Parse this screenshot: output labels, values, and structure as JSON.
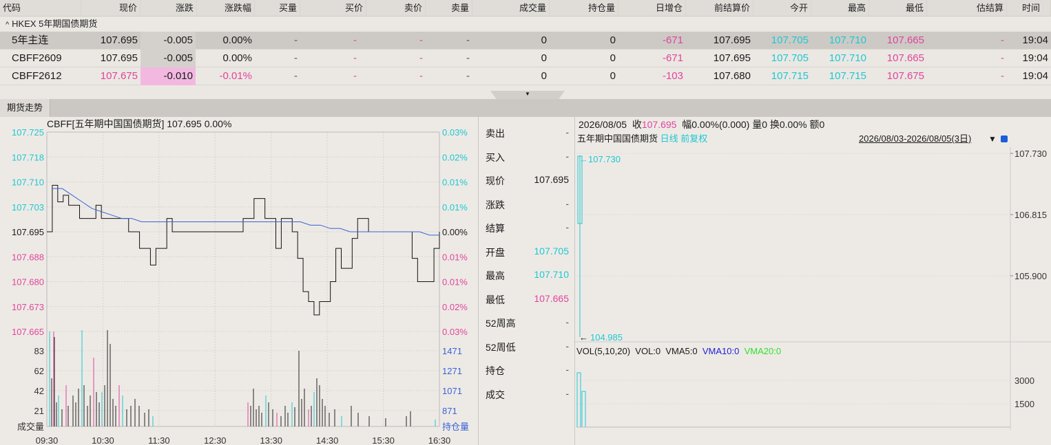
{
  "quote_table": {
    "headers": [
      "代码",
      "现价",
      "涨跌",
      "涨跌幅",
      "买量",
      "买价",
      "卖价",
      "卖量",
      "成交量",
      "持仓量",
      "日增仓",
      "前结算价",
      "今开",
      "最高",
      "最低",
      "估结算",
      "时间"
    ],
    "group_label": "HKEX 5年期国债期货",
    "rows": [
      {
        "code": "5年主连",
        "price": "107.695",
        "change": "-0.005",
        "pct": "0.00%",
        "bid_vol": "-",
        "bid": "-",
        "ask": "-",
        "ask_vol": "-",
        "volume": "0",
        "oi": "0",
        "oi_chg": "-671",
        "prev_settle": "107.695",
        "open": "107.705",
        "high": "107.710",
        "low": "107.665",
        "est_settle": "-",
        "time": "19:04"
      },
      {
        "code": "CBFF2609",
        "price": "107.695",
        "change": "-0.005",
        "pct": "0.00%",
        "bid_vol": "-",
        "bid": "-",
        "ask": "-",
        "ask_vol": "-",
        "volume": "0",
        "oi": "0",
        "oi_chg": "-671",
        "prev_settle": "107.695",
        "open": "107.705",
        "high": "107.710",
        "low": "107.665",
        "est_settle": "-",
        "time": "19:04"
      },
      {
        "code": "CBFF2612",
        "price": "107.675",
        "change": "-0.010",
        "pct": "-0.01%",
        "bid_vol": "-",
        "bid": "-",
        "ask": "-",
        "ask_vol": "-",
        "volume": "0",
        "oi": "0",
        "oi_chg": "-103",
        "prev_settle": "107.680",
        "open": "107.715",
        "high": "107.715",
        "low": "107.675",
        "est_settle": "-",
        "time": "19:04"
      }
    ]
  },
  "tab_label": "期货走势",
  "intraday": {
    "title": "CBFF[五年期中国国债期货]  107.695   0.00%",
    "price_ticks": [
      "107.725",
      "107.718",
      "107.710",
      "107.703",
      "107.695",
      "107.688",
      "107.680",
      "107.673",
      "107.665"
    ],
    "pct_ticks": [
      "0.03%",
      "0.02%",
      "0.01%",
      "0.01%",
      "0.00%",
      "0.01%",
      "0.01%",
      "0.02%",
      "0.03%"
    ],
    "vol_ticks": [
      "83",
      "62",
      "42",
      "21"
    ],
    "oi_ticks": [
      "1471",
      "1271",
      "1071",
      "871"
    ],
    "vol_label": "成交量",
    "oi_label": "持仓量",
    "time_ticks": [
      "09:30",
      "10:30",
      "11:30",
      "12:30",
      "13:30",
      "14:30",
      "15:30",
      "16:30"
    ]
  },
  "chart_data": {
    "type": "line",
    "title": "CBFF[五年期中国国债期货]  107.695   0.00%",
    "x": [
      "09:30",
      "10:30",
      "11:30",
      "12:30",
      "13:30",
      "14:30",
      "15:30",
      "16:30"
    ],
    "ylim": [
      107.665,
      107.725
    ],
    "series": [
      {
        "values": [
          107.695,
          107.705,
          107.698,
          107.695,
          107.695,
          107.695,
          107.698,
          107.682,
          107.685,
          107.695,
          107.695,
          107.69,
          107.698,
          107.695
        ]
      },
      {
        "values": [
          107.708,
          107.702,
          107.698,
          107.697,
          107.697,
          107.697,
          107.697,
          107.697,
          107.697,
          107.695,
          107.695,
          107.695,
          107.695,
          107.695
        ]
      }
    ]
  },
  "info": {
    "rows": [
      {
        "label": "卖出",
        "value": "-"
      },
      {
        "label": "买入",
        "value": "-"
      },
      {
        "label": "现价",
        "value": "107.695"
      },
      {
        "label": "涨跌",
        "value": "-"
      },
      {
        "label": "结算",
        "value": "-"
      },
      {
        "label": "开盘",
        "value": "107.705"
      },
      {
        "label": "最高",
        "value": "107.710"
      },
      {
        "label": "最低",
        "value": "107.665"
      },
      {
        "label": "52周高",
        "value": "-"
      },
      {
        "label": "52周低",
        "value": "-"
      },
      {
        "label": "持仓",
        "value": "-"
      },
      {
        "label": "成交",
        "value": "-"
      }
    ]
  },
  "kline": {
    "header_date": "2026/08/05",
    "header_close_label": "收",
    "header_close": "107.695",
    "header_rest": "幅0.00%(0.000)   量0   换0.00%   额0",
    "name": "五年期中国国债期货",
    "period": "日线",
    "adjust": "前复权",
    "range": "2026/08/03-2026/08/05(3日)",
    "y_ticks": [
      "107.730",
      "106.815",
      "105.900"
    ],
    "max_label": "107.730",
    "min_label": "104.985",
    "vol_legend": {
      "a": "VOL(5,10,20)",
      "b": "VOL:0",
      "c": "VMA5:0",
      "d": "VMA10:0",
      "e": "VMA20:0"
    },
    "vol_ticks": [
      "3000",
      "1500"
    ]
  },
  "colors": {
    "up": "#e0449b",
    "down": "#1fc7d2",
    "avg": "#3a62d8",
    "vma10": "#1c1cd8",
    "vma20": "#2ee02e"
  }
}
